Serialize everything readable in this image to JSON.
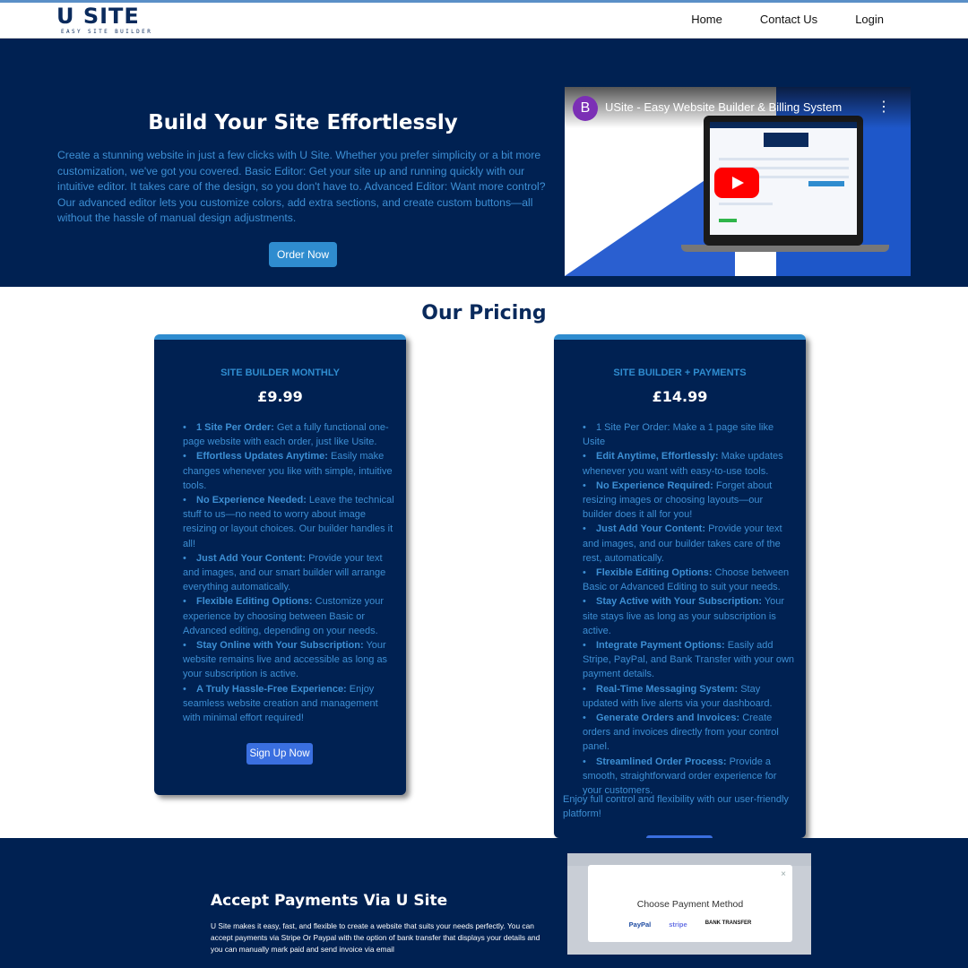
{
  "header": {
    "logo_main": "U SITE",
    "logo_sub": "EASY SITE BUILDER",
    "nav": [
      "Home",
      "Contact Us",
      "Login"
    ]
  },
  "hero": {
    "title": "Build Your Site Effortlessly",
    "text": "Create a stunning website in just a few clicks with U Site. Whether you prefer simplicity or a bit more customization, we've got you covered. Basic Editor: Get your site up and running quickly with our intuitive editor. It takes care of the design, so you don't have to. Advanced Editor: Want more control? Our advanced editor lets you customize colors, add extra sections, and create custom buttons—all without the hassle of manual design adjustments.",
    "button": "Order Now",
    "video": {
      "avatar": "B",
      "title": "USite - Easy Website Builder & Billing System",
      "menu_icon": "more-vert-icon",
      "play_icon": "youtube-play-icon"
    }
  },
  "pricing": {
    "title": "Our Pricing",
    "plans": [
      {
        "name": "SITE BUILDER MONTHLY",
        "price": "£9.99",
        "features": [
          {
            "bold": "1 Site Per Order:",
            "text": " Get a fully functional one-page website with each order, just like Usite."
          },
          {
            "bold": "Effortless Updates Anytime:",
            "text": " Easily make changes whenever you like with simple, intuitive tools."
          },
          {
            "bold": "No Experience Needed:",
            "text": " Leave the technical stuff to us—no need to worry about image resizing or layout choices. Our builder handles it all!"
          },
          {
            "bold": "Just Add Your Content:",
            "text": " Provide your text and images, and our smart builder will arrange everything automatically."
          },
          {
            "bold": "Flexible Editing Options:",
            "text": " Customize your experience by choosing between Basic or Advanced editing, depending on your needs."
          },
          {
            "bold": "Stay Online with Your Subscription:",
            "text": " Your website remains live and accessible as long as your subscription is active."
          },
          {
            "bold": "A Truly Hassle-Free Experience:",
            "text": " Enjoy seamless website creation and management with minimal effort required!"
          }
        ],
        "button": "Sign Up Now"
      },
      {
        "name": "SITE BUILDER + PAYMENTS",
        "price": "£14.99",
        "features": [
          {
            "bold": "",
            "text": "1 Site Per Order: Make a 1 page site like Usite"
          },
          {
            "bold": "Edit Anytime, Effortlessly:",
            "text": " Make updates whenever you want with easy-to-use tools."
          },
          {
            "bold": "No Experience Required:",
            "text": " Forget about resizing images or choosing layouts—our builder does it all for you!"
          },
          {
            "bold": "Just Add Your Content:",
            "text": " Provide your text and images, and our builder takes care of the rest, automatically."
          },
          {
            "bold": "Flexible Editing Options:",
            "text": " Choose between Basic or Advanced Editing to suit your needs."
          },
          {
            "bold": "Stay Active with Your Subscription:",
            "text": " Your site stays live as long as your subscription is active."
          },
          {
            "bold": "Integrate Payment Options:",
            "text": " Easily add Stripe, PayPal, and Bank Transfer with your own payment details."
          },
          {
            "bold": "Real-Time Messaging System:",
            "text": " Stay updated with live alerts via your dashboard."
          },
          {
            "bold": "Generate Orders and Invoices:",
            "text": " Create orders and invoices directly from your control panel."
          },
          {
            "bold": "Streamlined Order Process:",
            "text": " Provide a smooth, straightforward order experience for your customers."
          }
        ],
        "extra": "Enjoy full control and flexibility with our user-friendly platform!"
      }
    ]
  },
  "payments": {
    "title": "Accept Payments Via U Site",
    "text": "U Site makes it easy, fast, and flexible to create a website that suits your needs perfectly. You can accept payments via Stripe Or Paypal with the option of bank transfer that displays your details and you can manually mark paid and send invoice via email",
    "modal": {
      "title": "Choose Payment Method",
      "close": "×",
      "options": [
        "PayPal",
        "stripe",
        "BANK TRANSFER"
      ]
    }
  }
}
